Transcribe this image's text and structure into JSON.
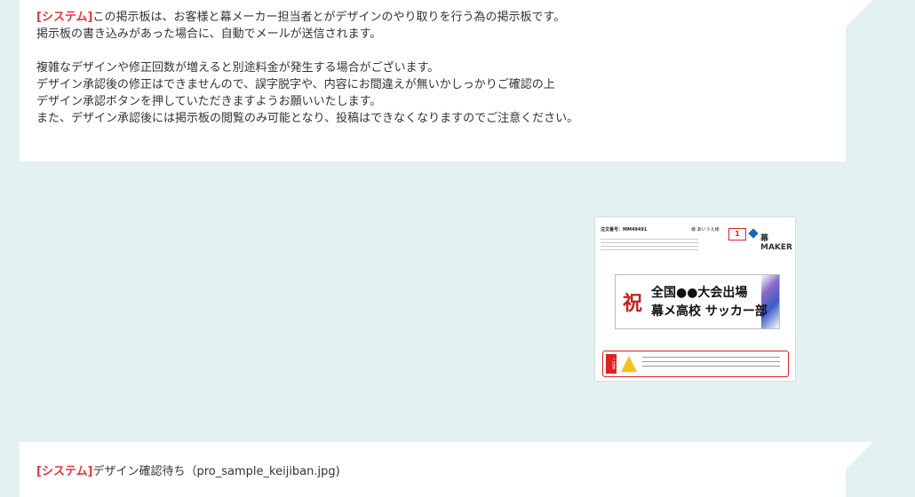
{
  "system_message": {
    "tag": "[システム]",
    "line1_rest": "この掲示板は、お客様と幕メーカー担当者とがデザインのやり取りを行う為の掲示板です。",
    "line2": "掲示板の書き込みがあった場合に、自動でメールが送信されます。",
    "line3": "複雑なデザインや修正回数が増えると別途料金が発生する場合がございます。",
    "line4": "デザイン承認後の修正はできませんので、誤字脱字や、内容にお間違えが無いかしっかりご確認の上",
    "line5": "デザイン承認ボタンを押していただきますようお願いいたします。",
    "line6": "また、デザイン承認後には掲示板の閲覧のみ可能となり、投稿はできなくなりますのでご注意ください。"
  },
  "thumbnail": {
    "order_no": "注文番号：MM49491",
    "name": "様 あいうえ様",
    "badge": "1",
    "logo_text": "幕MAKER",
    "iwai": "祝",
    "banner_line1": "全国●●大会出場",
    "banner_line2": "幕メ高校 サッカー部",
    "notice_label": "ご注意"
  },
  "status_message": {
    "tag": "[システム]",
    "text": "デザイン確認待ち（pro_sample_keijiban.jpg)"
  },
  "colors": {
    "background": "#e4f1f2",
    "tag": "#e8343c",
    "bubble": "#ffffff"
  }
}
